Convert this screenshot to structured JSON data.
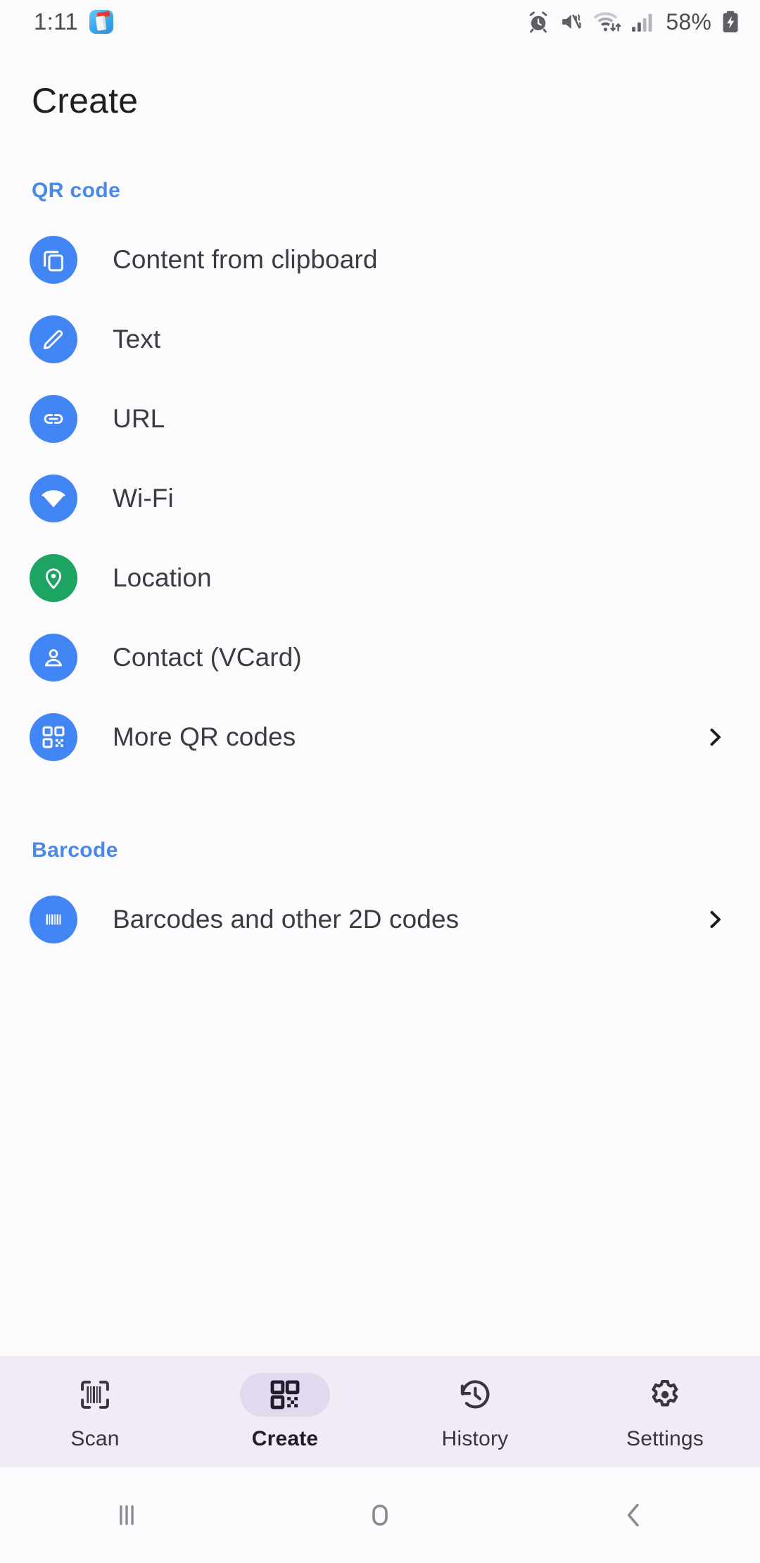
{
  "status_bar": {
    "clock": "1:11",
    "battery_percent": "58%",
    "icons": [
      "cleaner-app-icon",
      "alarm-icon",
      "mute-vibrate-icon",
      "wifi-transfer-icon",
      "signal-bars-icon",
      "battery-charging-icon"
    ]
  },
  "header": {
    "title": "Create"
  },
  "sections": [
    {
      "title": "QR code",
      "items": [
        {
          "label": "Content from clipboard",
          "icon": "clipboard-copy-icon",
          "color": "#4285f4",
          "chevron": false
        },
        {
          "label": "Text",
          "icon": "pencil-icon",
          "color": "#4285f4",
          "chevron": false
        },
        {
          "label": "URL",
          "icon": "link-icon",
          "color": "#4285f4",
          "chevron": false
        },
        {
          "label": "Wi-Fi",
          "icon": "wifi-icon",
          "color": "#4285f4",
          "chevron": false
        },
        {
          "label": "Location",
          "icon": "location-pin-icon",
          "color": "#1da462",
          "chevron": true
        },
        {
          "label": "Contact (VCard)",
          "icon": "person-icon",
          "color": "#4285f4",
          "chevron": false
        },
        {
          "label": "More QR codes",
          "icon": "qr-code-icon",
          "color": "#4285f4",
          "chevron": true
        }
      ]
    },
    {
      "title": "Barcode",
      "items": [
        {
          "label": "Barcodes and other 2D codes",
          "icon": "barcode-icon",
          "color": "#4285f4",
          "chevron": true
        }
      ]
    }
  ],
  "bottom_nav": {
    "active": "Create",
    "tabs": [
      {
        "label": "Scan",
        "icon": "scan-barcode-icon"
      },
      {
        "label": "Create",
        "icon": "qr-code-icon"
      },
      {
        "label": "History",
        "icon": "history-clock-icon"
      },
      {
        "label": "Settings",
        "icon": "gear-icon"
      }
    ]
  },
  "system_nav": {
    "buttons": [
      {
        "name": "recents-button",
        "icon": "recents-bars-icon"
      },
      {
        "name": "home-button",
        "icon": "home-square-icon"
      },
      {
        "name": "back-button",
        "icon": "chevron-left-icon"
      }
    ]
  },
  "colors": {
    "accent_blue": "#4285f4",
    "section_header_blue": "#4a89e8",
    "location_green": "#1da462",
    "nav_background": "#f1ebf6",
    "nav_active_pill": "#e3d9ef",
    "page_background": "#fbfafd"
  }
}
